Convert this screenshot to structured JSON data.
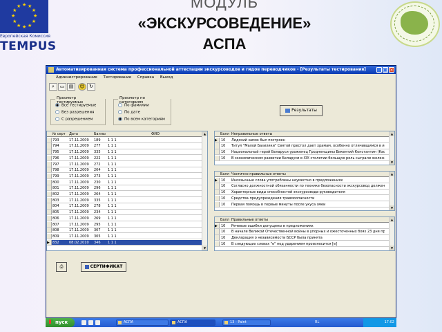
{
  "header": {
    "eu_caption": "Европейская Комиссия",
    "tempus": "TEMPUS",
    "title_line1": "МОДУЛЬ",
    "title_line2": "«ЭКСКУРСОВЕДЕНИЕ»",
    "title_line3": "АСПА"
  },
  "window": {
    "title": "Автоматизированная система профессиональной аттестации экскурсоводов и гидов переводчиков - [Результаты тестирования]",
    "menu": [
      "Администрирование",
      "Тестирование",
      "Справка",
      "Выход"
    ]
  },
  "filters": {
    "group1_label": "Просмотр тестируемых",
    "group1_options": [
      "Все тестируемые",
      "Без разрешения",
      "С разрешением"
    ],
    "group1_selected": 0,
    "group2_label": "Просмотр по категориям",
    "group2_options": [
      "По фамилии",
      "По дате",
      "По всем категориям"
    ],
    "group2_selected": 2,
    "results_button": "Результаты"
  },
  "main_table": {
    "columns": [
      "№ серт",
      "Дата",
      "Баллы",
      "ФИО"
    ],
    "rows": [
      [
        "793",
        "17.11.2009",
        "189",
        "1 1 1"
      ],
      [
        "794",
        "17.11.2009",
        "277",
        "1 1 1"
      ],
      [
        "795",
        "17.11.2009",
        "335",
        "1 1 1"
      ],
      [
        "796",
        "17.11.2009",
        "222",
        "1 1 1"
      ],
      [
        "797",
        "17.11.2009",
        "272",
        "1 1 1"
      ],
      [
        "798",
        "17.11.2009",
        "204",
        "1 1 1"
      ],
      [
        "799",
        "17.11.2009",
        "273",
        "1 1 1"
      ],
      [
        "800",
        "17.11.2009",
        "230",
        "1 1 1"
      ],
      [
        "801",
        "17.11.2009",
        "296",
        "1 1 1"
      ],
      [
        "802",
        "17.11.2009",
        "264",
        "1 1 1"
      ],
      [
        "803",
        "17.11.2009",
        "335",
        "1 1 1"
      ],
      [
        "804",
        "17.11.2009",
        "278",
        "1 1 1"
      ],
      [
        "805",
        "17.11.2009",
        "234",
        "1 1 1"
      ],
      [
        "806",
        "17.11.2009",
        "269",
        "1 1 1"
      ],
      [
        "807",
        "17.11.2009",
        "295",
        "1 1 1"
      ],
      [
        "808",
        "17.11.2009",
        "307",
        "1 1 1"
      ],
      [
        "809",
        "17.11.2009",
        "305",
        "1 1 1"
      ],
      [
        "832",
        "08.02.2010",
        "346",
        "1 1 1"
      ]
    ],
    "selected_row": 17
  },
  "panel_wrong": {
    "columns": [
      "Балл",
      "Неправильные ответы"
    ],
    "rows": [
      [
        "10",
        "Лидский замок был построен"
      ],
      [
        "10",
        "Титул \"Малой Базилики\" Святой престол дает храмам, особенно отличившимся в истори"
      ],
      [
        "10",
        "Национальный герой Беларуси уроженец Гродненщины Викентий Константин (Кастусь) К"
      ],
      [
        "10",
        "В экономическом развитии Беларуси в XIX столетии большую роль сыграли железные д"
      ]
    ]
  },
  "panel_partial": {
    "columns": [
      "Балл",
      "Частично правильные ответы"
    ],
    "rows": [
      [
        "10",
        "Иноязычные слова употреблены неуместно в предложениях"
      ],
      [
        "10",
        "Согласно должностной обязанности по технике безопасности экскурсовод должен знать"
      ],
      [
        "10",
        "Характерные виды способностей экскурсовода-руководителя"
      ],
      [
        "10",
        "Средства предупреждения травмоопасности"
      ],
      [
        "10",
        "Первая помощь в первые минуты после укуса змеи"
      ]
    ]
  },
  "panel_correct": {
    "columns": [
      "Балл",
      "Правильные ответы"
    ],
    "rows": [
      [
        "10",
        "Речевые ошибки допущены в предложениях"
      ],
      [
        "10",
        "В начале Великой Отечественной войны в упорных и ожесточенных боях 23 дня продолж"
      ],
      [
        "10",
        "Декларация о независимости БССР была принята"
      ],
      [
        "10",
        "В следующих словах \"е\" под ударением произносится [е]"
      ]
    ]
  },
  "bottom": {
    "certificate_button": "СЕРТИФИКАТ"
  },
  "taskbar": {
    "start": "пуск",
    "tasks": [
      "АСПА",
      "АСПА",
      "13 - Paint"
    ],
    "lang": "RL",
    "clock": "17:02"
  }
}
